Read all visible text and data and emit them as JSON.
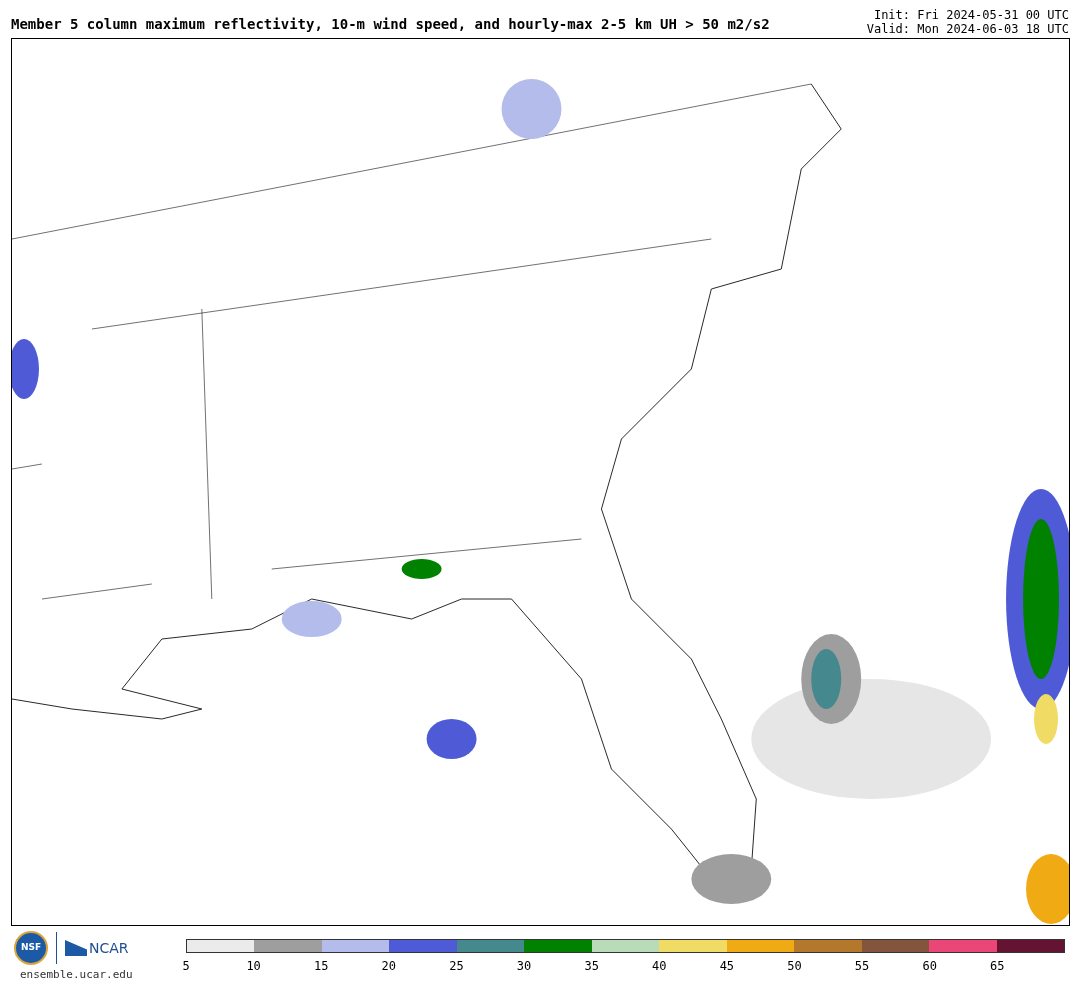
{
  "header": {
    "title": "Member 5 column maximum reflectivity, 10-m wind speed, and hourly-max 2-5 km UH > 50 m2/s2",
    "init": "Init: Fri 2024-05-31 00 UTC",
    "valid": "Valid: Mon 2024-06-03 18 UTC"
  },
  "footer": {
    "nsf_logo": "NSF",
    "ncar_logo": "NCAR",
    "url": "ensemble.ucar.edu"
  },
  "colorbar": {
    "segments": [
      {
        "color": "#ebebeb"
      },
      {
        "color": "#9e9e9e"
      },
      {
        "color": "#b4bcec"
      },
      {
        "color": "#4e5ad6"
      },
      {
        "color": "#45898f"
      },
      {
        "color": "#008200"
      },
      {
        "color": "#b8dcb8"
      },
      {
        "color": "#f0dc64"
      },
      {
        "color": "#f0aa14"
      },
      {
        "color": "#b4782d"
      },
      {
        "color": "#82553c"
      },
      {
        "color": "#eb4678"
      },
      {
        "color": "#641432"
      }
    ],
    "ticks": [
      "5",
      "10",
      "15",
      "20",
      "25",
      "30",
      "35",
      "40",
      "45",
      "50",
      "55",
      "60",
      "65"
    ]
  }
}
